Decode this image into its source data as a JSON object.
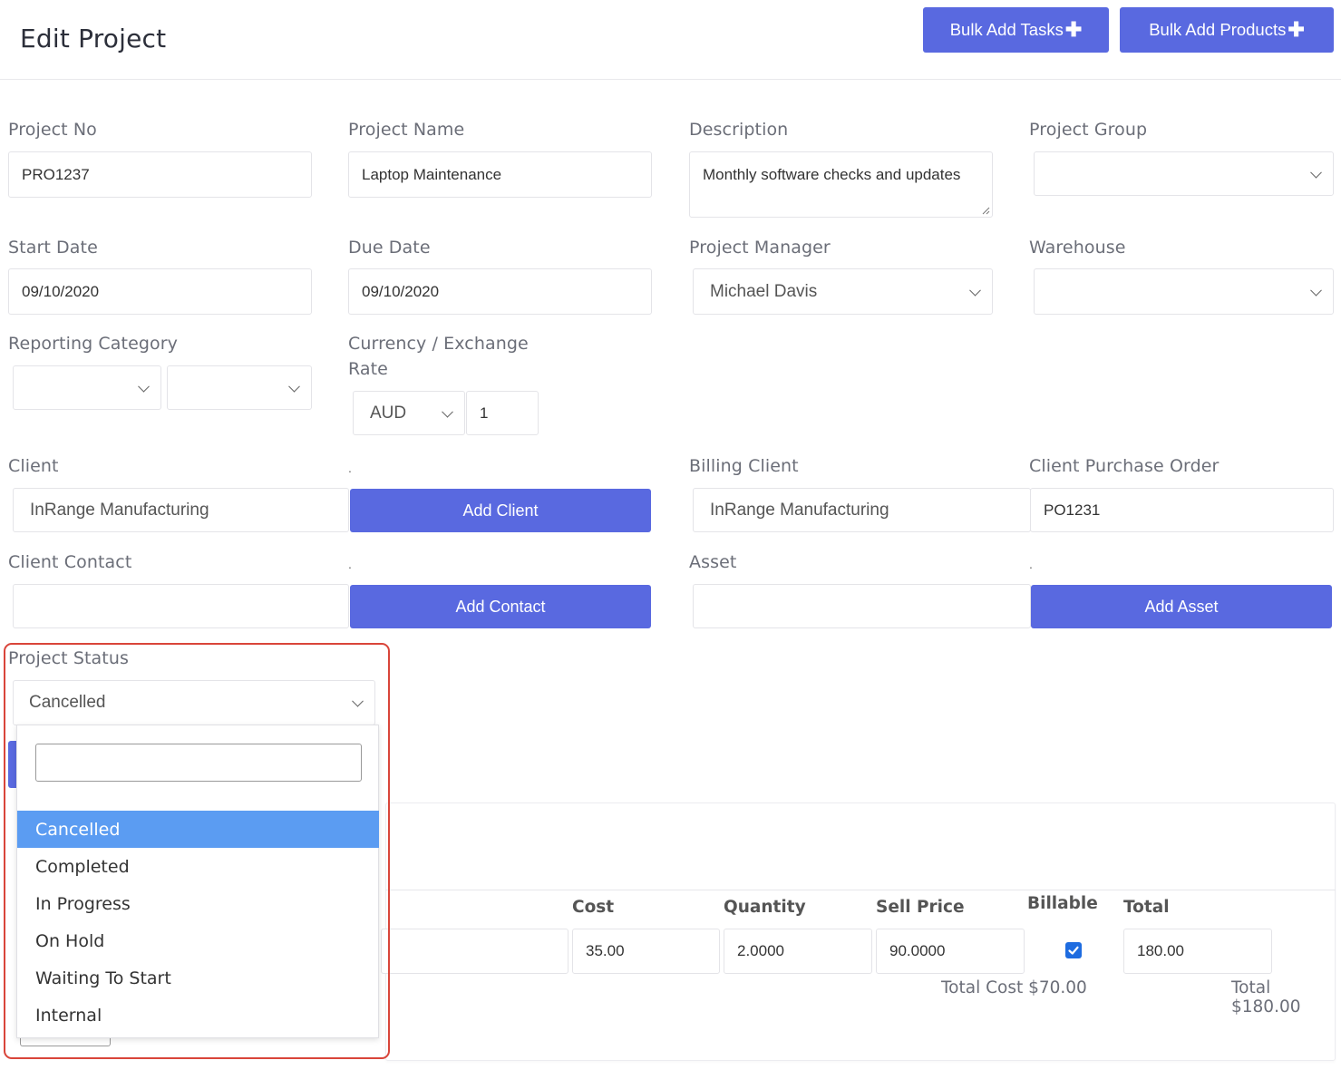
{
  "header": {
    "title": "Edit Project",
    "bulk_add_tasks": "Bulk Add Tasks",
    "bulk_add_products": "Bulk Add Products"
  },
  "form": {
    "project_no": {
      "label": "Project No",
      "value": "PRO1237"
    },
    "project_name": {
      "label": "Project Name",
      "value": "Laptop Maintenance"
    },
    "description": {
      "label": "Description",
      "value": "Monthly software checks and updates"
    },
    "project_group": {
      "label": "Project Group",
      "value": ""
    },
    "start_date": {
      "label": "Start Date",
      "value": "09/10/2020"
    },
    "due_date": {
      "label": "Due Date",
      "value": "09/10/2020"
    },
    "project_manager": {
      "label": "Project Manager",
      "value": "Michael Davis"
    },
    "warehouse": {
      "label": "Warehouse",
      "value": ""
    },
    "reporting_category": {
      "label": "Reporting Category"
    },
    "currency": {
      "label_line1": "Currency / Exchange",
      "label_line2": "Rate",
      "currency": "AUD",
      "rate": "1"
    },
    "client": {
      "label": "Client",
      "value": "InRange Manufacturing",
      "add_button": "Add Client"
    },
    "billing_client": {
      "label": "Billing Client",
      "value": "InRange Manufacturing"
    },
    "client_po": {
      "label": "Client Purchase Order",
      "value": "PO1231"
    },
    "client_contact": {
      "label": "Client Contact",
      "value": "",
      "add_button": "Add Contact"
    },
    "asset": {
      "label": "Asset",
      "value": "",
      "add_button": "Add Asset"
    },
    "spacer_dot": ".",
    "project_status": {
      "label": "Project Status",
      "value": "Cancelled",
      "options": [
        "Cancelled",
        "Completed",
        "In Progress",
        "On Hold",
        "Waiting To Start",
        "Internal"
      ]
    }
  },
  "table": {
    "headers": {
      "cost": "Cost",
      "quantity": "Quantity",
      "sell_price": "Sell Price",
      "billable": "Billable",
      "total": "Total"
    },
    "row": {
      "cost": "35.00",
      "quantity": "2.0000",
      "sell_price": "90.0000",
      "billable": true,
      "total": "180.00"
    },
    "total_cost": "Total Cost $70.00",
    "total": "Total $180.00"
  },
  "colors": {
    "primary": "#5969e0",
    "selected_option": "#5b9cf2",
    "highlight": "#d9453a"
  }
}
